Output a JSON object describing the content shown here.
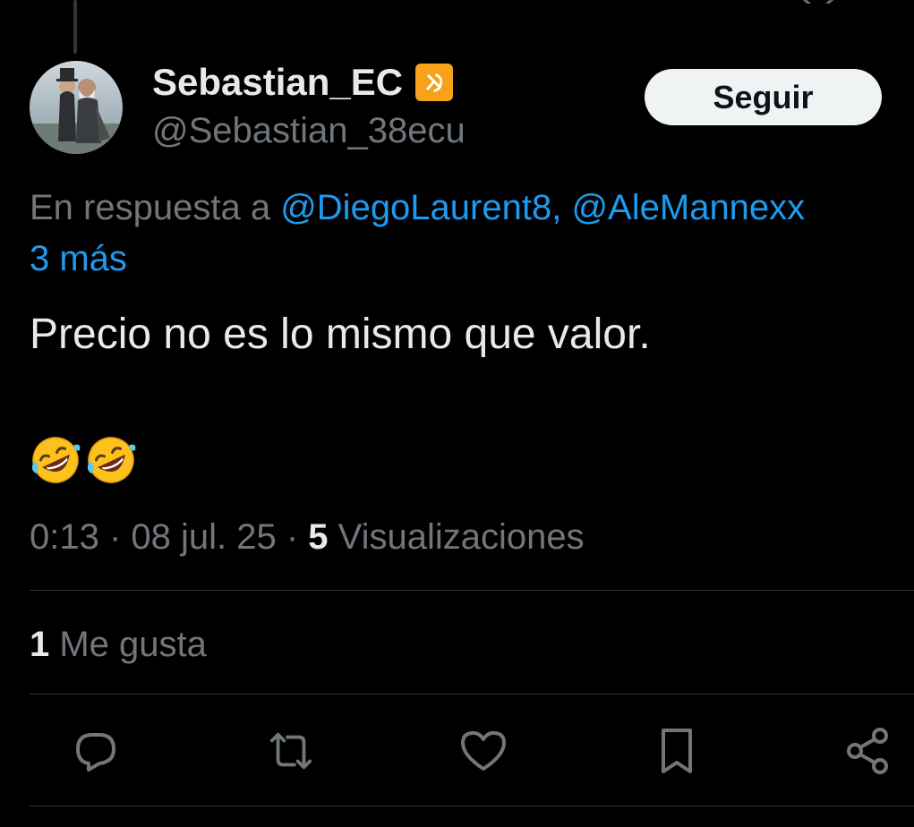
{
  "tweet": {
    "display_name": "Sebastian_EC",
    "handle": "@Sebastian_38ecu",
    "follow_label": "Seguir",
    "reply_prefix": "En respuesta a ",
    "mentions": [
      "@DiegoLaurent8",
      "@AleMannexx"
    ],
    "mention_separator": ", ",
    "more_replies": "3 más",
    "text": "Precio no es lo mismo que valor.",
    "emojis": [
      "rolling-on-floor-laughing-emoji",
      "rolling-on-floor-laughing-emoji"
    ],
    "time": "0:13",
    "separator": " · ",
    "date": "08 jul. 25",
    "views_count": "5",
    "views_label": " Visualizaciones",
    "likes_count": "1",
    "likes_label": " Me gusta"
  },
  "icons": {
    "name_badge": "hammer-and-sickle-icon",
    "actions": [
      "reply-icon",
      "retweet-icon",
      "like-icon",
      "bookmark-icon",
      "share-icon"
    ]
  },
  "colors": {
    "background": "#000000",
    "primary_text": "#e7e9ea",
    "secondary_text": "#71767b",
    "link": "#1d9bf0",
    "divider": "#2f3336",
    "follow_button_bg": "#eff3f4",
    "badge": "#f7a21a"
  }
}
